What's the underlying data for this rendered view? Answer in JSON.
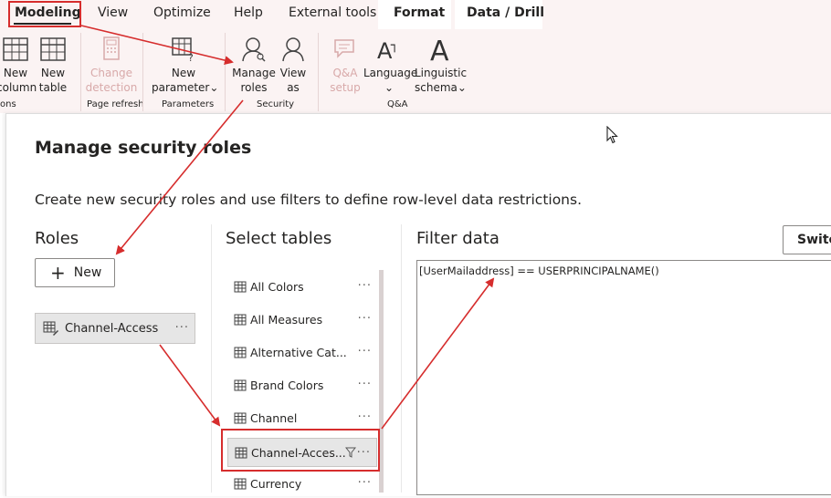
{
  "menubar": {
    "items": [
      "Modeling",
      "View",
      "Optimize",
      "Help",
      "External tools",
      "Format",
      "Data / Drill"
    ]
  },
  "ribbon": {
    "new_column": [
      "New",
      "column"
    ],
    "new_table": [
      "New",
      "table"
    ],
    "change_detection": [
      "Change",
      "detection"
    ],
    "new_parameter": [
      "New",
      "parameter"
    ],
    "manage_roles": [
      "Manage",
      "roles"
    ],
    "view_as": [
      "View",
      "as"
    ],
    "qa_setup": [
      "Q&A",
      "setup"
    ],
    "language": "Language",
    "linguistic_schema": [
      "Linguistic",
      "schema"
    ],
    "groups": {
      "calculations_tail": "ons",
      "page_refresh": "Page refresh",
      "parameters": "Parameters",
      "security": "Security",
      "qa": "Q&A"
    }
  },
  "dialog": {
    "title": "Manage security roles",
    "description": "Create new security roles and use filters to define row-level data restrictions.",
    "roles_header": "Roles",
    "tables_header": "Select tables",
    "filter_header": "Filter data",
    "new_button": "New",
    "switch_button": "Switch",
    "roles": [
      "Channel-Access"
    ],
    "tables": [
      {
        "label": "All Colors"
      },
      {
        "label": "All Measures"
      },
      {
        "label": "Alternative Cat..."
      },
      {
        "label": "Brand Colors"
      },
      {
        "label": "Channel"
      },
      {
        "label": "Channel-Acces..."
      },
      {
        "label": "Currency"
      }
    ],
    "selected_table_index": 5,
    "filter_expression": "[UserMailaddress] == USERPRINCIPALNAME()"
  },
  "colors": {
    "annotation_red": "#d62d2d",
    "ribbon_bg": "#fbf3f3",
    "selected_bg": "#e6e6e6"
  },
  "icons": [
    "table-icon",
    "calculator-icon",
    "parameter-icon",
    "manage-roles-icon",
    "view-as-icon",
    "qa-icon",
    "language-icon",
    "linguistic-icon",
    "role-icon",
    "filter-icon",
    "plus-icon",
    "cursor-icon"
  ]
}
